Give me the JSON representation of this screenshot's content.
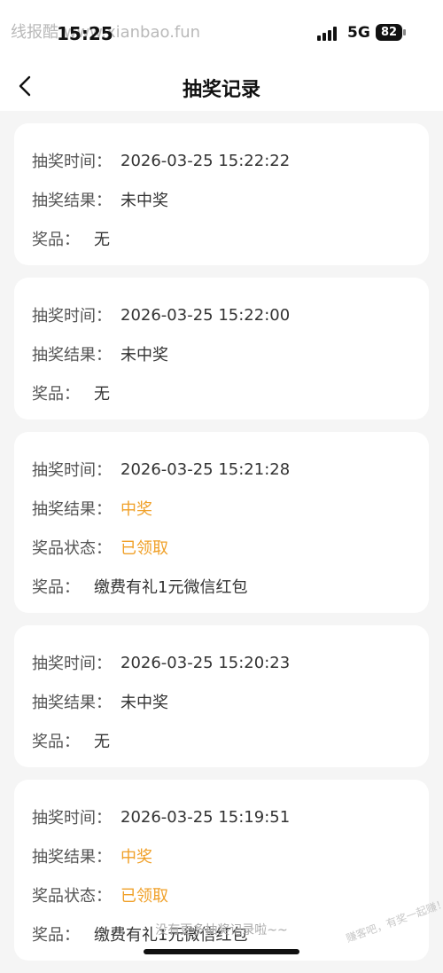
{
  "status": {
    "watermark": "线报酷 www.xianbao.fun",
    "time": "15:25",
    "network": "5G",
    "battery": "82"
  },
  "nav": {
    "title": "抽奖记录",
    "back_icon": "chevron-left-icon"
  },
  "labels": {
    "time": "抽奖时间：",
    "result": "抽奖结果：",
    "status": "奖品状态：",
    "prize": "奖品："
  },
  "records": [
    {
      "time": "2026-03-25 15:22:22",
      "result": "未中奖",
      "prize": "无"
    },
    {
      "time": "2026-03-25 15:22:00",
      "result": "未中奖",
      "prize": "无"
    },
    {
      "time": "2026-03-25 15:21:28",
      "result": "中奖",
      "status": "已领取",
      "prize": "缴费有礼1元微信红包"
    },
    {
      "time": "2026-03-25 15:20:23",
      "result": "未中奖",
      "prize": "无"
    },
    {
      "time": "2026-03-25 15:19:51",
      "result": "中奖",
      "status": "已领取",
      "prize": "缴费有礼1元微信红包"
    }
  ],
  "footer": {
    "note": "没有更多抽奖记录啦~~",
    "watermark": "赚客吧，有奖一起赚！www.zuanke8.com"
  },
  "colors": {
    "highlight": "#f0a028",
    "background": "#f5f5f5",
    "card": "#ffffff"
  }
}
